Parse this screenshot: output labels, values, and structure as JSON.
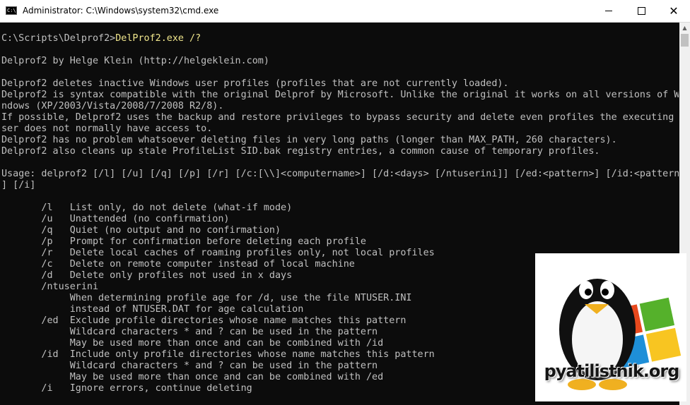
{
  "window": {
    "title": "Administrator: C:\\Windows\\system32\\cmd.exe",
    "app_icon_text": "C:\\",
    "minimize_glyph": "",
    "close_glyph": "✕"
  },
  "console": {
    "prompt": "C:\\Scripts\\Delprof2>",
    "command": "DelProf2.exe /?",
    "lines": {
      "l01": "Delprof2 by Helge Klein (http://helgeklein.com)",
      "l02": "Delprof2 deletes inactive Windows user profiles (profiles that are not currently loaded).",
      "l03": "Delprof2 is syntax compatible with the original Delprof by Microsoft. Unlike the original it works on all versions of Wi",
      "l04": "ndows (XP/2003/Vista/2008/7/2008 R2/8).",
      "l05": "If possible, Delprof2 uses the backup and restore privileges to bypass security and delete even profiles the executing u",
      "l06": "ser does not normally have access to.",
      "l07": "Delprof2 has no problem whatsoever deleting files in very long paths (longer than MAX_PATH, 260 characters).",
      "l08": "Delprof2 also cleans up stale ProfileList SID.bak registry entries, a common cause of temporary profiles.",
      "l09": "Usage: delprof2 [/l] [/u] [/q] [/p] [/r] [/c:[\\\\]<computername>] [/d:<days> [/ntuserini]] [/ed:<pattern>] [/id:<pattern>",
      "l10": "] [/i]",
      "l11": "       /l   List only, do not delete (what-if mode)",
      "l12": "       /u   Unattended (no confirmation)",
      "l13": "       /q   Quiet (no output and no confirmation)",
      "l14": "       /p   Prompt for confirmation before deleting each profile",
      "l15": "       /r   Delete local caches of roaming profiles only, not local profiles",
      "l16": "       /c   Delete on remote computer instead of local machine",
      "l17": "       /d   Delete only profiles not used in x days",
      "l18": "       /ntuserini",
      "l19": "            When determining profile age for /d, use the file NTUSER.INI",
      "l20": "            instead of NTUSER.DAT for age calculation",
      "l21": "       /ed  Exclude profile directories whose name matches this pattern",
      "l22": "            Wildcard characters * and ? can be used in the pattern",
      "l23": "            May be used more than once and can be combined with /id",
      "l24": "       /id  Include only profile directories whose name matches this pattern",
      "l25": "            Wildcard characters * and ? can be used in the pattern",
      "l26": "            May be used more than once and can be combined with /ed",
      "l27": "       /i   Ignore errors, continue deleting"
    }
  },
  "scrollbar": {
    "up_glyph": "▲"
  },
  "watermark": {
    "text": "pyatilistnik.org"
  },
  "colors": {
    "console_bg": "#0c0c0c",
    "console_text": "#c0c0c0",
    "command_text": "#f0e68c",
    "titlebar_bg": "#ffffff"
  }
}
